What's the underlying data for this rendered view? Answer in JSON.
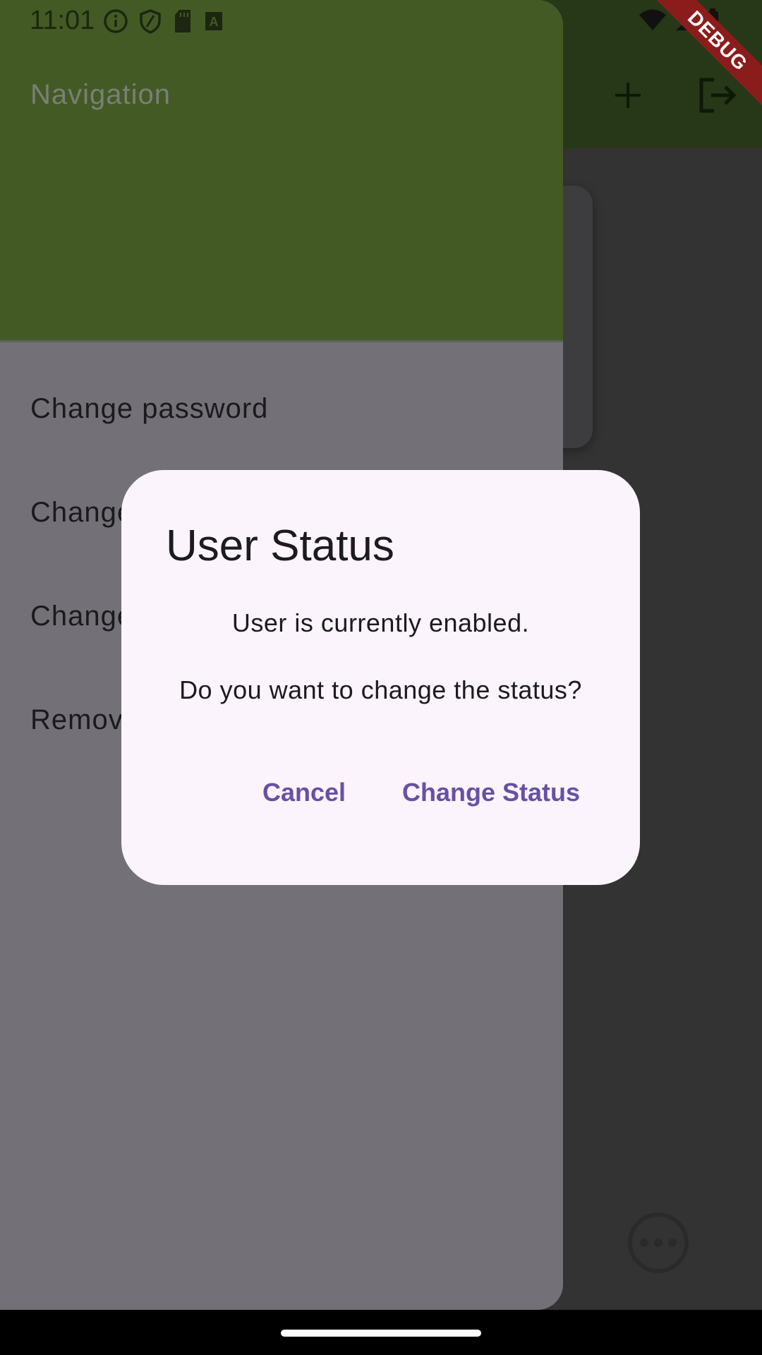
{
  "status_bar": {
    "time": "11:01",
    "left_icons": [
      "info-icon",
      "shield-icon",
      "sd-card-icon",
      "a-box-icon"
    ],
    "right_icons": [
      "wifi-icon",
      "cell-signal-icon",
      "battery-icon"
    ]
  },
  "app_bar": {
    "actions": [
      "add-icon",
      "logout-icon"
    ]
  },
  "debug_banner": "DEBUG",
  "drawer": {
    "header_title": "Navigation",
    "items": [
      {
        "label": "Change password"
      },
      {
        "label": "Change"
      },
      {
        "label": "Change"
      },
      {
        "label": "Remov"
      }
    ]
  },
  "dialog": {
    "title": "User Status",
    "message": "User is currently enabled.",
    "question": "Do you want to change the status?",
    "cancel_label": "Cancel",
    "confirm_label": "Change Status"
  },
  "colors": {
    "app_bar": "#263817",
    "drawer_header": "#435a25",
    "drawer_body": "#737177",
    "dialog_bg": "#fcf4fc",
    "accent": "#6750a4",
    "debug_banner": "#8b1c1c"
  }
}
